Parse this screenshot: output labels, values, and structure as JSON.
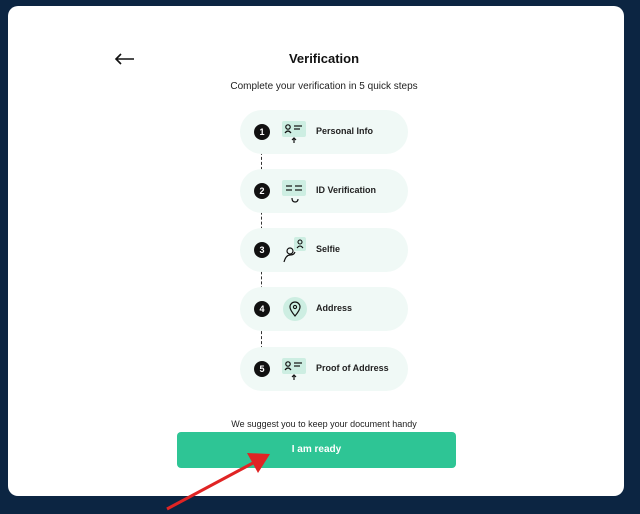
{
  "header": {
    "back_icon": "arrow-left-icon",
    "title": "Verification",
    "subtitle": "Complete your verification in 5 quick steps"
  },
  "steps": [
    {
      "number": "1",
      "label": "Personal Info",
      "icon": "id-card-upload-icon"
    },
    {
      "number": "2",
      "label": "ID Verification",
      "icon": "document-scan-icon"
    },
    {
      "number": "3",
      "label": "Selfie",
      "icon": "selfie-icon"
    },
    {
      "number": "4",
      "label": "Address",
      "icon": "location-pin-icon"
    },
    {
      "number": "5",
      "label": "Proof of Address",
      "icon": "id-card-upload-icon"
    }
  ],
  "footer": {
    "hint": "We suggest you to keep your document handy",
    "button_label": "I am ready"
  },
  "colors": {
    "background": "#0c2542",
    "card": "#ffffff",
    "accent": "#2ec595",
    "step_bg": "#f0f9f6",
    "icon_bg": "#cdeee2",
    "annotation": "#e02424"
  }
}
